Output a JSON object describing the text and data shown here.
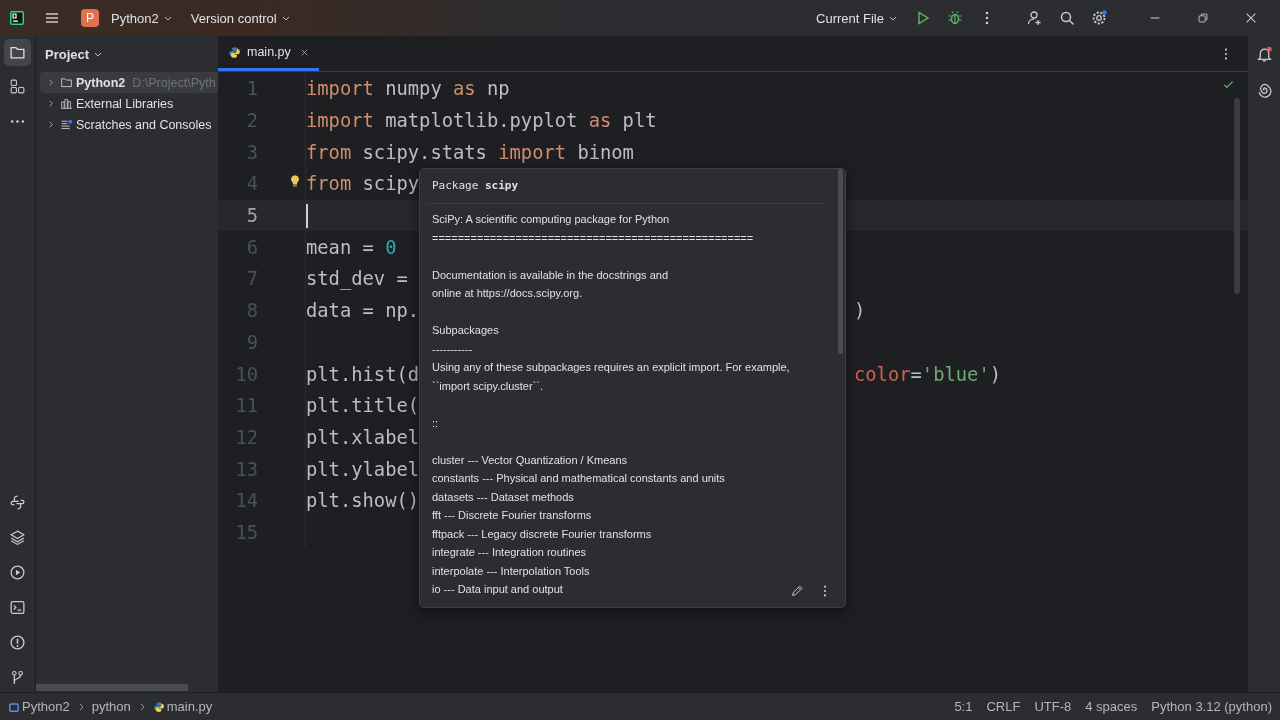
{
  "title_bar": {
    "project_badge": "P",
    "project": "Python2",
    "vcs": "Version control",
    "run_config": "Current File"
  },
  "project_panel": {
    "title": "Project",
    "items": [
      {
        "label": "Python2",
        "path": "D:\\Project\\Pyth",
        "kind": "folder",
        "selected": true,
        "expanded": false
      },
      {
        "label": "External Libraries",
        "kind": "library",
        "selected": false,
        "expanded": false
      },
      {
        "label": "Scratches and Consoles",
        "kind": "scratch",
        "selected": false,
        "expanded": false
      }
    ]
  },
  "tabs": [
    {
      "label": "main.py",
      "selected": true
    }
  ],
  "code_lines": [
    {
      "number": "1",
      "current": false,
      "tokens": [
        {
          "kind": "kw",
          "text": "import"
        },
        {
          "kind": "plain",
          "text": " numpy "
        },
        {
          "kind": "kw",
          "text": "as"
        },
        {
          "kind": "plain",
          "text": " np"
        }
      ]
    },
    {
      "number": "2",
      "current": false,
      "tokens": [
        {
          "kind": "kw",
          "text": "import"
        },
        {
          "kind": "plain",
          "text": " matplotlib.pyplot "
        },
        {
          "kind": "kw",
          "text": "as"
        },
        {
          "kind": "plain",
          "text": " plt"
        }
      ]
    },
    {
      "number": "3",
      "current": false,
      "tokens": [
        {
          "kind": "kw",
          "text": "from"
        },
        {
          "kind": "plain",
          "text": " scipy.stats "
        },
        {
          "kind": "kw",
          "text": "import"
        },
        {
          "kind": "plain",
          "text": " binom"
        }
      ]
    },
    {
      "number": "4",
      "current": false,
      "tokens": [
        {
          "kind": "kw",
          "text": "from"
        },
        {
          "kind": "plain",
          "text": " scipy"
        }
      ]
    },
    {
      "number": "5",
      "current": true
    },
    {
      "number": "6",
      "current": false,
      "tokens": [
        {
          "kind": "plain",
          "text": "mean = "
        },
        {
          "kind": "num",
          "text": "0"
        }
      ]
    },
    {
      "number": "7",
      "current": false,
      "tokens": [
        {
          "kind": "plain",
          "text": "std_dev ="
        }
      ]
    },
    {
      "number": "8",
      "current": false,
      "tokens": [
        {
          "kind": "plain",
          "text": "data = np."
        }
      ],
      "tail": [
        {
          "kind": "plain",
          "text": ")"
        }
      ]
    },
    {
      "number": "9",
      "current": false
    },
    {
      "number": "10",
      "current": false,
      "tokens": [
        {
          "kind": "plain",
          "text": "plt.hist(d"
        }
      ],
      "tail": [
        {
          "kind": "param",
          "text": "color"
        },
        {
          "kind": "plain",
          "text": "="
        },
        {
          "kind": "str",
          "text": "'blue'"
        },
        {
          "kind": "plain",
          "text": ")"
        }
      ]
    },
    {
      "number": "11",
      "current": false,
      "tokens": [
        {
          "kind": "plain",
          "text": "plt.title("
        }
      ]
    },
    {
      "number": "12",
      "current": false,
      "tokens": [
        {
          "kind": "plain",
          "text": "plt.xlabel"
        }
      ]
    },
    {
      "number": "13",
      "current": false,
      "tokens": [
        {
          "kind": "plain",
          "text": "plt.ylabel"
        }
      ]
    },
    {
      "number": "14",
      "current": false,
      "tokens": [
        {
          "kind": "plain",
          "text": "plt.show()"
        }
      ]
    },
    {
      "number": "15",
      "current": false
    }
  ],
  "doc_popup": {
    "title": "Package **scipy**",
    "paragraphs": [
      [
        "SciPy: A scientific computing package for Python",
        "=================================================="
      ],
      [
        "Documentation is available in the docstrings and",
        "online at https://docs.scipy.org."
      ],
      [
        "Subpackages",
        "-----------",
        "Using any of these subpackages requires an explicit import. For example,",
        "``import scipy.cluster``."
      ],
      [
        "::"
      ],
      [
        "cluster --- Vector Quantization / Kmeans",
        "constants --- Physical and mathematical constants and units",
        "datasets --- Dataset methods",
        "fft --- Discrete Fourier transforms",
        "fftpack --- Legacy discrete Fourier transforms",
        "integrate --- Integration routines",
        "interpolate --- Interpolation Tools",
        "io --- Data input and output"
      ]
    ]
  },
  "status_bar": {
    "breadcrumbs": [
      "Python2",
      "python",
      "main.py"
    ],
    "items": [
      "5:1",
      "CRLF",
      "UTF-8",
      "4 spaces",
      "Python 3.12 (python)"
    ]
  }
}
